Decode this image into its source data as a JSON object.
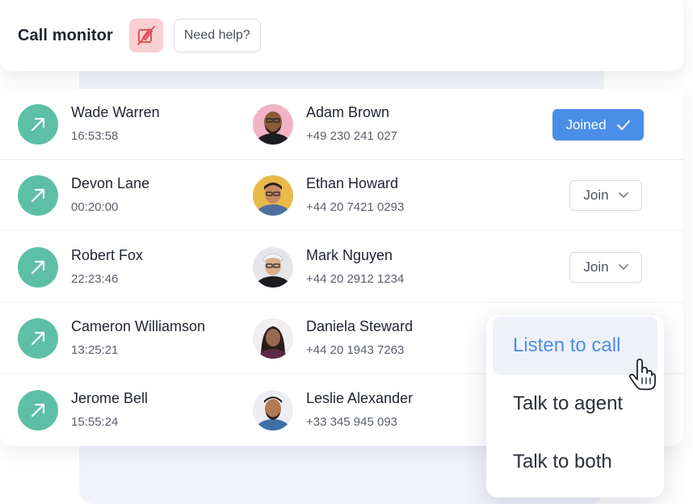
{
  "header": {
    "title": "Call monitor",
    "help_label": "Need help?",
    "mute_icon": "muted-pen-icon",
    "mute_bg": "#f9cfd2",
    "mute_color": "#e0525e"
  },
  "colors": {
    "call_icon_bg": "#5dbfa6",
    "accent_blue": "#4a8ee8"
  },
  "calls": [
    {
      "agent": "Wade Warren",
      "duration": "16:53:58",
      "contact": "Adam Brown",
      "phone": "+49 230 241 027",
      "action": "Joined",
      "action_state": "joined"
    },
    {
      "agent": "Devon Lane",
      "duration": "00:20:00",
      "contact": "Ethan Howard",
      "phone": "+44 20 7421 0293",
      "action": "Join",
      "action_state": "join"
    },
    {
      "agent": "Robert Fox",
      "duration": "22:23:46",
      "contact": "Mark Nguyen",
      "phone": "+44 20 2912 1234",
      "action": "Join",
      "action_state": "join"
    },
    {
      "agent": "Cameron Williamson",
      "duration": "13:25:21",
      "contact": "Daniela Steward",
      "phone": "+44 20 1943 7263",
      "action": "",
      "action_state": "menu-open"
    },
    {
      "agent": "Jerome Bell",
      "duration": "15:55:24",
      "contact": "Leslie Alexander",
      "phone": "+33 345 945 093",
      "action": "",
      "action_state": "menu-open"
    }
  ],
  "join_menu": {
    "items": [
      "Listen to call",
      "Talk to agent",
      "Talk to both"
    ],
    "active_item": "Listen to call"
  }
}
